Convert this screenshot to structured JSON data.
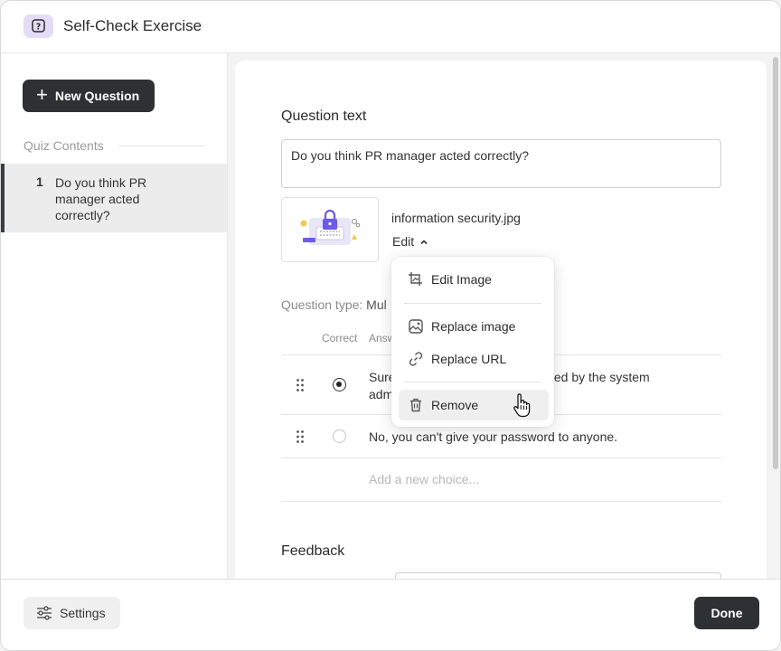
{
  "header": {
    "title": "Self-Check Exercise",
    "icon": "question-square-icon"
  },
  "sidebar": {
    "new_question_label": "New Question",
    "quiz_contents_label": "Quiz Contents",
    "items": [
      {
        "number": "1",
        "text": "Do you think PR manager acted correctly?"
      }
    ]
  },
  "editor": {
    "question_text_label": "Question text",
    "question_text_value": "Do you think PR manager acted correctly?",
    "image": {
      "file_name": "information security.jpg",
      "edit_label": "Edit"
    },
    "question_type_label": "Question type:",
    "question_type_value": "Mul",
    "columns": {
      "correct": "Correct",
      "answer": "Answ"
    },
    "answers": [
      {
        "line1_start": "Sure",
        "line1_end": "ted by the system",
        "line2": "adm",
        "correct": true
      },
      {
        "text": "No, you can't give your password to anyone.",
        "correct": false
      }
    ],
    "add_choice_placeholder": "Add a new choice...",
    "feedback_label": "Feedback"
  },
  "image_menu": {
    "items": [
      {
        "label": "Edit Image",
        "icon": "crop-image-icon"
      },
      {
        "label": "Replace image",
        "icon": "image-replace-icon"
      },
      {
        "label": "Replace URL",
        "icon": "link-icon"
      },
      {
        "label": "Remove",
        "icon": "trash-icon"
      }
    ]
  },
  "footer": {
    "settings_label": "Settings",
    "done_label": "Done"
  },
  "colors": {
    "primary_dark": "#2e3133",
    "accent_lavender": "#e3dcf7",
    "illustration_purple": "#6b5be6"
  }
}
